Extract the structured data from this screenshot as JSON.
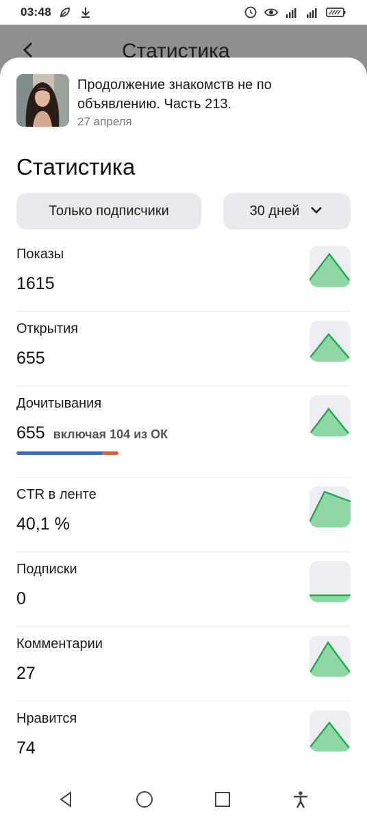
{
  "status_bar": {
    "time": "03:48",
    "icons": [
      "leaf-icon",
      "download-icon",
      "alarm-icon",
      "eye-icon",
      "signal-4g-icon",
      "signal-icon",
      "battery-icon"
    ]
  },
  "backdrop": {
    "title": "Статистика"
  },
  "article": {
    "title": "Продолжение знакомств не по объявлению. Часть 213.",
    "date": "27 апреля"
  },
  "section_title": "Статистика",
  "filters": {
    "audience": "Только подписчики",
    "period": "30 дней"
  },
  "metrics": [
    {
      "label": "Показы",
      "value": "1615"
    },
    {
      "label": "Открытия",
      "value": "655"
    },
    {
      "label": "Дочитывания",
      "value": "655",
      "extra": "включая 104 из ОК"
    },
    {
      "label": "CTR в ленте",
      "value": "40,1 %"
    },
    {
      "label": "Подписки",
      "value": "0"
    },
    {
      "label": "Комментарии",
      "value": "27"
    },
    {
      "label": "Нравится",
      "value": "74"
    }
  ],
  "read_share": {
    "dzen_fraction": 0.84,
    "ok_fraction": 0.16
  },
  "colors": {
    "accent_green": "#1fae4c",
    "spark_fill": "#8fd7a4",
    "chip_bg": "#e8eaee",
    "bar_blue": "#2a6fe0",
    "bar_orange": "#ee5a2a"
  },
  "nav": [
    "back-triangle-icon",
    "home-circle-icon",
    "recents-square-icon",
    "accessibility-icon"
  ]
}
